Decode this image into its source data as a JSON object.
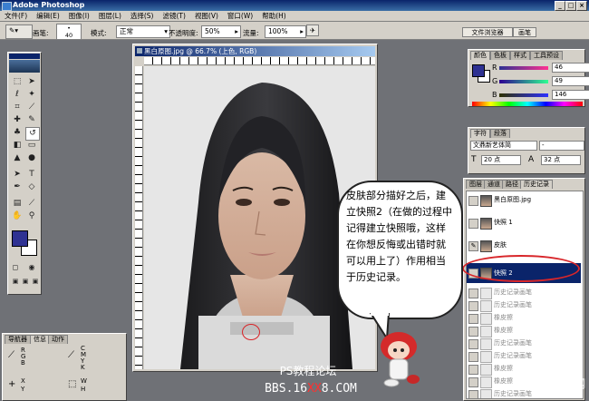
{
  "app": {
    "title": "Adobe Photoshop"
  },
  "menu": [
    "文件(F)",
    "编辑(E)",
    "图像(I)",
    "图层(L)",
    "选择(S)",
    "滤镜(T)",
    "视图(V)",
    "窗口(W)",
    "帮助(H)"
  ],
  "options_bar": {
    "brush_label": "画笔:",
    "brush_size": "40",
    "mode_label": "模式:",
    "mode_value": "正常",
    "opacity_label": "不透明度:",
    "opacity_value": "50%",
    "flow_label": "流量:",
    "flow_value": "100%",
    "panel_well": [
      "文件浏览器",
      "画笔"
    ]
  },
  "document": {
    "title": "黑白原图.jpg @ 66.7% (上色, RGB)"
  },
  "color_panel": {
    "tabs": [
      "颜色",
      "色板",
      "样式",
      "工具预设"
    ],
    "channels": [
      {
        "name": "R",
        "value": "46"
      },
      {
        "name": "G",
        "value": "49"
      },
      {
        "name": "B",
        "value": "146"
      }
    ],
    "fg_color": "#2e3192"
  },
  "character_panel": {
    "tabs": [
      "字符",
      "段落"
    ],
    "font": "文鼎新艺体简",
    "style": "-",
    "size": "20 点",
    "leading": "32 点"
  },
  "history_panel": {
    "tabs": [
      "图层",
      "通道",
      "路径",
      "历史记录"
    ],
    "snapshots": [
      "黑白原图.jpg",
      "快照 1",
      "皮肤",
      "快照 2"
    ],
    "steps": [
      "历史记录画笔",
      "历史记录画笔",
      "橡皮擦",
      "橡皮擦",
      "历史记录画笔",
      "历史记录画笔",
      "橡皮擦",
      "橡皮擦",
      "历史记录画笔"
    ]
  },
  "bubble": {
    "text": "皮肤部分描好之后，建立快照2（在做的过程中记得建立快照哦，这样在你想反悔或出错时就可以用上了）作用相当于历史记录。"
  },
  "nav_panel": {
    "tabs": [
      "导航器",
      "信息",
      "动作"
    ],
    "rgb_labels": [
      "R",
      "G",
      "B"
    ],
    "cmyk_labels": [
      "C",
      "M",
      "Y",
      "K"
    ],
    "xy_labels": [
      "X",
      "Y"
    ],
    "wh_labels": [
      "W",
      "H"
    ]
  },
  "watermarks": {
    "forum": "PS教程论坛",
    "url_prefix": "BBS.16",
    "url_highlight": "XX",
    "url_suffix": "8.COM",
    "site": "中国教程网"
  },
  "colors": {
    "title_bar": "#0a246a",
    "chrome": "#d4d0c8",
    "workspace": "#6f7176",
    "selection": "#0a246a",
    "highlight_ellipse": "#d8262a"
  }
}
